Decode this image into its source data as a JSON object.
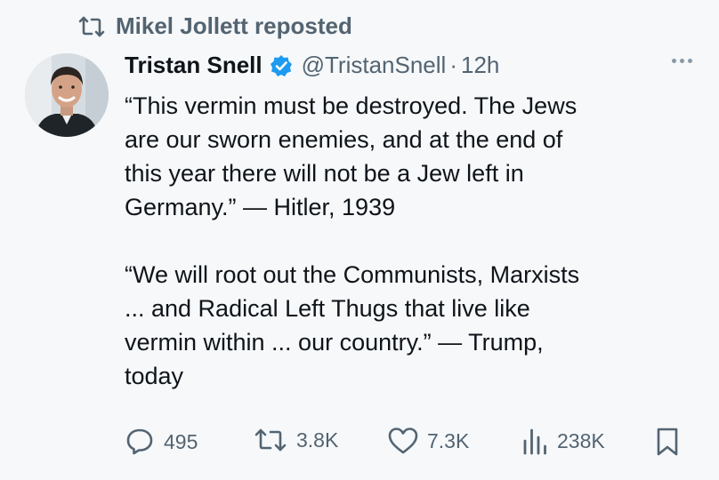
{
  "repost": {
    "label": "Mikel Jollett reposted",
    "icon": "repost-icon"
  },
  "author": {
    "name": "Tristan Snell",
    "handle": "@TristanSnell",
    "separator": "·",
    "time": "12h",
    "verified_color": "#1d9bf0"
  },
  "tweet": {
    "lines": [
      "“This vermin must be destroyed. The Jews",
      "are our sworn enemies, and at the end of",
      "this year there will not be a Jew left in",
      "Germany.”  — Hitler, 1939",
      "“We will root out the Communists, Marxists",
      "... and Radical Left Thugs that live like",
      "vermin within ... our country.” — Trump,",
      "today"
    ]
  },
  "actions": {
    "replies": "495",
    "reposts": "3.8K",
    "likes": "7.3K",
    "views": "238K"
  },
  "colors": {
    "background": "#f6f8fa",
    "text": "#0f1419",
    "secondary": "#536471",
    "accent": "#1d9bf0"
  }
}
